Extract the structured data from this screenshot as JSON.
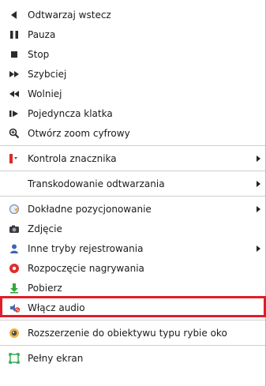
{
  "menu": {
    "colors": {
      "highlight_border": "#e11d2a",
      "separator": "#cfcfcf"
    },
    "items": [
      {
        "label": "Odtwarzaj wstecz",
        "icon": "play-backward-icon"
      },
      {
        "label": "Pauza",
        "icon": "pause-icon"
      },
      {
        "label": "Stop",
        "icon": "stop-icon"
      },
      {
        "label": "Szybciej",
        "icon": "fast-forward-icon"
      },
      {
        "label": "Wolniej",
        "icon": "slow-backward-icon"
      },
      {
        "label": "Pojedyncza klatka",
        "icon": "single-frame-icon"
      },
      {
        "label": "Otwórz zoom cyfrowy",
        "icon": "zoom-icon"
      },
      {
        "label": "Kontrola znacznika",
        "icon": "bookmark-icon",
        "submenu": true
      },
      {
        "label": "Transkodowanie odtwarzania",
        "icon": "",
        "submenu": true
      },
      {
        "label": "Dokładne pozycjonowanie",
        "icon": "positioning-icon",
        "submenu": true
      },
      {
        "label": "Zdjęcie",
        "icon": "camera-icon"
      },
      {
        "label": "Inne tryby rejestrowania",
        "icon": "user-icon",
        "submenu": true
      },
      {
        "label": "Rozpoczęcie nagrywania",
        "icon": "record-icon"
      },
      {
        "label": "Pobierz",
        "icon": "download-icon",
        "selected": true
      },
      {
        "label": "Włącz audio",
        "icon": "audio-icon"
      },
      {
        "label": "Rozszerzenie do obiektywu typu rybie oko",
        "icon": "fisheye-icon"
      },
      {
        "label": "Pełny ekran",
        "icon": "fullscreen-icon"
      }
    ]
  }
}
